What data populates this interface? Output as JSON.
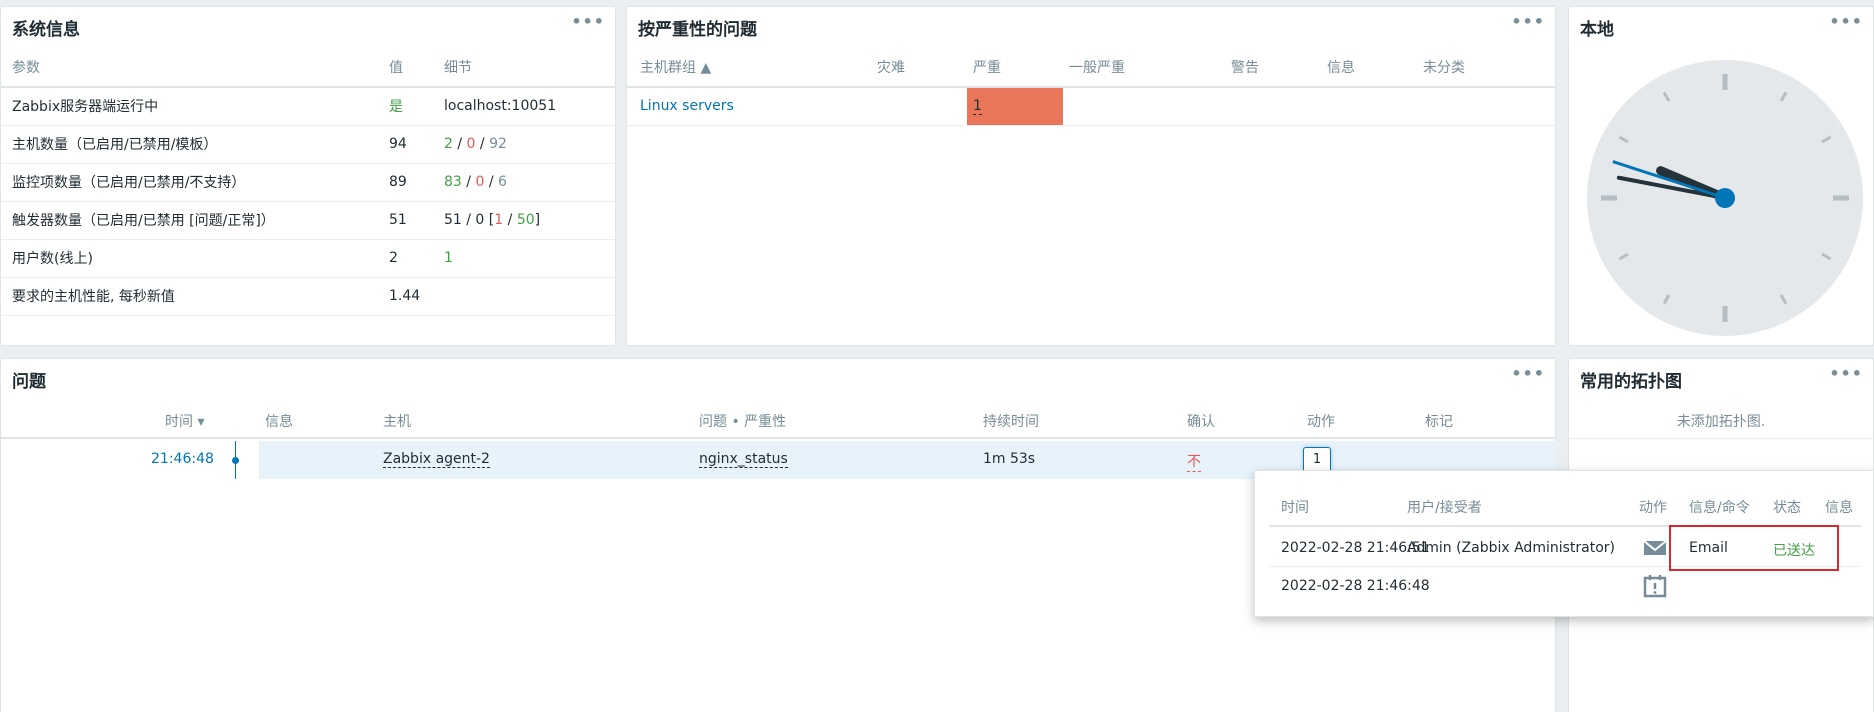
{
  "sysinfo": {
    "title": "系统信息",
    "cols": [
      "参数",
      "值",
      "细节"
    ],
    "rows": [
      {
        "param": "Zabbix服务器端运行中",
        "value": "是",
        "detail": "localhost:10051"
      },
      {
        "param": "主机数量（已启用/已禁用/模板）",
        "value": "94",
        "d1": "2",
        "d2": "0",
        "d3": "92"
      },
      {
        "param": "监控项数量（已启用/已禁用/不支持）",
        "value": "89",
        "d1": "83",
        "d2": "0",
        "d3": "6"
      },
      {
        "param": "触发器数量（已启用/已禁用 [问题/正常]）",
        "value": "51",
        "pre": "51 / 0 [",
        "p": "1",
        "n": "50"
      },
      {
        "param": "用户数(线上)",
        "value": "2",
        "d1": "1"
      },
      {
        "param": "要求的主机性能, 每秒新值",
        "value": "1.44"
      }
    ]
  },
  "severity": {
    "title": "按严重性的问题",
    "cols": [
      "主机群组 ▲",
      "灾难",
      "严重",
      "一般严重",
      "警告",
      "信息",
      "未分类"
    ],
    "row": {
      "group": "Linux servers",
      "high": "1"
    }
  },
  "local": {
    "title": "本地"
  },
  "problems": {
    "title": "问题",
    "cols": [
      "时间 ▾",
      "信息",
      "主机",
      "问题 • 严重性",
      "持续时间",
      "确认",
      "动作",
      "标记"
    ],
    "row": {
      "time": "21:46:48",
      "host": "Zabbix agent-2",
      "problem": "nginx_status",
      "duration": "1m 53s",
      "ack": "不",
      "actions": "1"
    }
  },
  "maps": {
    "title": "常用的拓扑图",
    "empty": "未添加拓扑图."
  },
  "popup": {
    "cols": [
      "时间",
      "用户/接受者",
      "动作",
      "信息/命令",
      "状态",
      "信息"
    ],
    "rows": [
      {
        "time": "2022-02-28 21:46:51",
        "user": "Admin (Zabbix Administrator)",
        "cmd": "Email",
        "status": "已送达"
      },
      {
        "time": "2022-02-28 21:46:48"
      }
    ]
  },
  "colors": {
    "high": "#e97659",
    "ok": "#429e47",
    "problem": "#e45959",
    "link": "#0275b8"
  },
  "clock": {
    "time": "21:46:48"
  }
}
